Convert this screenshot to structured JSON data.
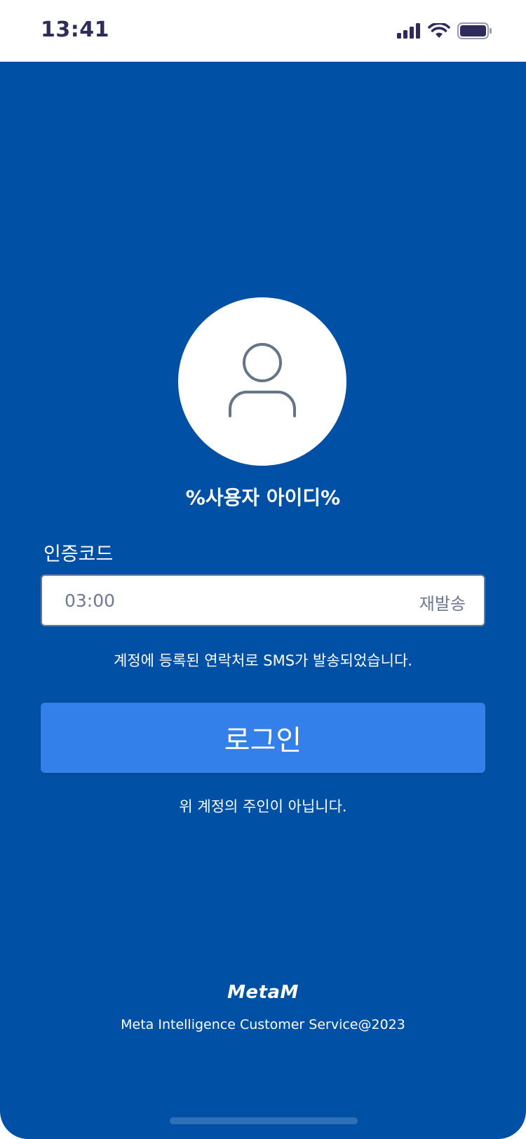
{
  "status_bar": {
    "time": "13:41",
    "icons": [
      "signal-icon",
      "wifi-icon",
      "battery-icon"
    ]
  },
  "user": {
    "avatar_icon": "user-icon",
    "id": "%사용자 아이디%"
  },
  "verification": {
    "label": "인증코드",
    "placeholder": "03:00",
    "resend_label": "재발송",
    "notice": "계정에 등록된 연락처로 SMS가 발송되었습니다."
  },
  "login": {
    "button_label": "로그인",
    "not_owner_link": "위 계정의 주인이 아닙니다."
  },
  "footer": {
    "brand": "MetaM",
    "copyright": "Meta Intelligence Customer Service@2023"
  },
  "colors": {
    "background": "#0051a6",
    "button": "#3380eb",
    "status_text": "#2d2c5a",
    "muted": "#6b7a90"
  }
}
